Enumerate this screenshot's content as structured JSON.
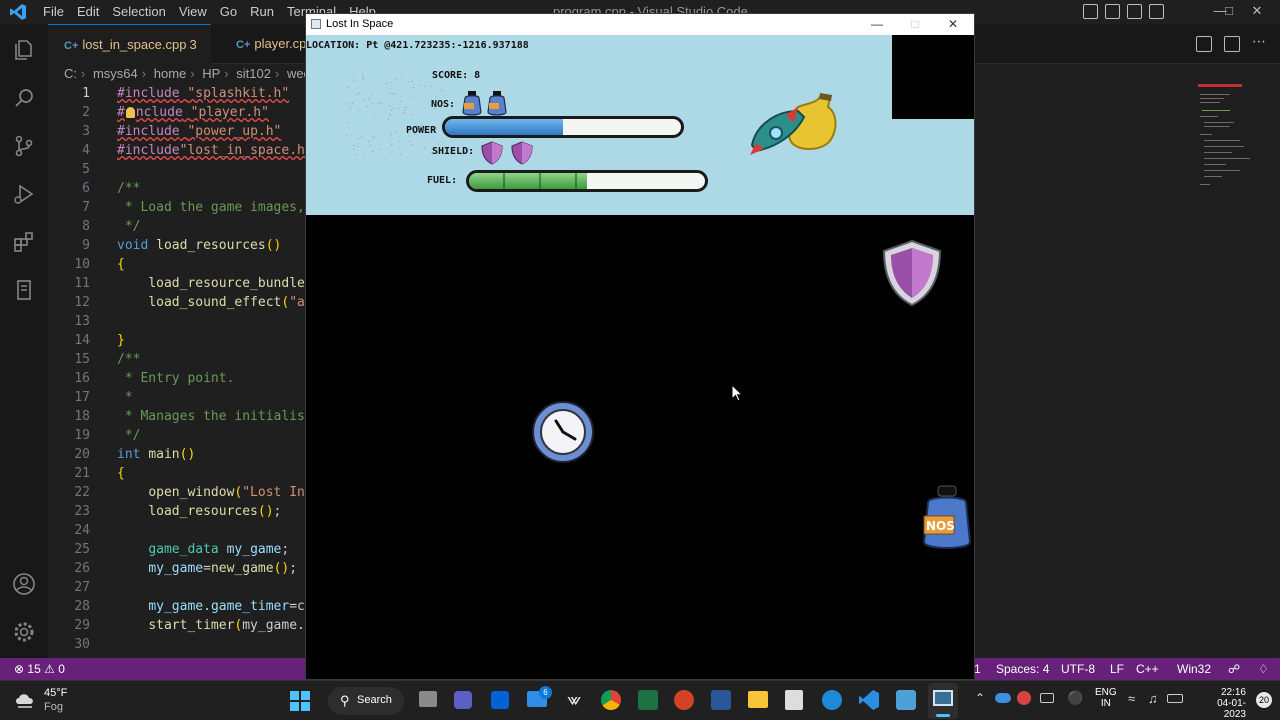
{
  "vscode": {
    "menu": [
      "File",
      "Edit",
      "Selection",
      "View",
      "Go",
      "Run",
      "Terminal",
      "Help"
    ],
    "window_title": "program.cpp - Visual Studio Code",
    "tabs": [
      {
        "name": "lost_in_space.cpp",
        "count": "3"
      },
      {
        "name": "player.cpp",
        "count": ""
      }
    ],
    "breadcrumb": [
      "C:",
      "msys64",
      "home",
      "HP",
      "sit102",
      "wee"
    ],
    "code": [
      {
        "n": "1",
        "text": "#include \"splashkit.h\""
      },
      {
        "n": "2",
        "text": "#include \"player.h\""
      },
      {
        "n": "3",
        "text": "#include \"power_up.h\""
      },
      {
        "n": "4",
        "text": "#include\"lost_in_space.h\""
      },
      {
        "n": "5",
        "text": ""
      },
      {
        "n": "6",
        "text": "/**"
      },
      {
        "n": "7",
        "text": " * Load the game images,"
      },
      {
        "n": "8",
        "text": " */"
      },
      {
        "n": "9",
        "text": "void load_resources()"
      },
      {
        "n": "10",
        "text": "{"
      },
      {
        "n": "11",
        "text": "    load_resource_bundle("
      },
      {
        "n": "12",
        "text": "    load_sound_effect(\"ap"
      },
      {
        "n": "13",
        "text": ""
      },
      {
        "n": "14",
        "text": "}"
      },
      {
        "n": "15",
        "text": "/**"
      },
      {
        "n": "16",
        "text": " * Entry point."
      },
      {
        "n": "17",
        "text": " *"
      },
      {
        "n": "18",
        "text": " * Manages the initialisa"
      },
      {
        "n": "19",
        "text": " */"
      },
      {
        "n": "20",
        "text": "int main()"
      },
      {
        "n": "21",
        "text": "{"
      },
      {
        "n": "22",
        "text": "    open_window(\"Lost In"
      },
      {
        "n": "23",
        "text": "    load_resources();"
      },
      {
        "n": "24",
        "text": ""
      },
      {
        "n": "25",
        "text": "    game_data my_game;"
      },
      {
        "n": "26",
        "text": "    my_game=new_game();"
      },
      {
        "n": "27",
        "text": ""
      },
      {
        "n": "28",
        "text": "    my_game.game_timer=cr"
      },
      {
        "n": "29",
        "text": "    start_timer(my_game.g"
      },
      {
        "n": "30",
        "text": ""
      }
    ],
    "status": {
      "errors": "15",
      "warnings": "0",
      "ln": "1",
      "spaces": "Spaces: 4",
      "encoding": "UTF-8",
      "eol": "LF",
      "language": "C++",
      "platform": "Win32"
    }
  },
  "game": {
    "window_title": "Lost In Space",
    "location": "LOCATION: Pt @421.723235:-1216.937188",
    "score": "SCORE: 8",
    "nos_label": "NOS:",
    "power_label": "POWER",
    "shield_label": "SHIELD:",
    "fuel_label": "FUEL:",
    "power_level": 0.5,
    "fuel_level": 0.5,
    "nos_count": 2,
    "shield_count": 2,
    "nos_sprite_text": "NOS"
  },
  "taskbar": {
    "weather_temp": "45°F",
    "weather_desc": "Fog",
    "search_label": "Search",
    "badge": "6",
    "lang1": "ENG",
    "lang2": "IN",
    "time": "22:16",
    "date": "04-01-2023",
    "notif_count": "20"
  },
  "colors": {
    "statusbar": "#68217a",
    "hud_bg": "#add8e6",
    "power_bar": "#3d8fd8",
    "fuel_bar": "#5cb35a"
  }
}
